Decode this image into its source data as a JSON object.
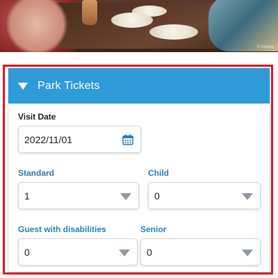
{
  "hero": {
    "copyright": "© Disney",
    "alt": "restaurant-dining-photo"
  },
  "panel": {
    "title": "Park Tickets",
    "highlight_color": "#e0141e",
    "header_color": "#2f9ad8"
  },
  "visit_date": {
    "label": "Visit Date",
    "value": "2022/11/01"
  },
  "tickets": {
    "standard": {
      "label": "Standard",
      "value": "1"
    },
    "child": {
      "label": "Child",
      "value": "0"
    },
    "guest_disabilities": {
      "label": "Guest with disabilities",
      "value": "0"
    },
    "senior": {
      "label": "Senior",
      "value": "0"
    }
  }
}
